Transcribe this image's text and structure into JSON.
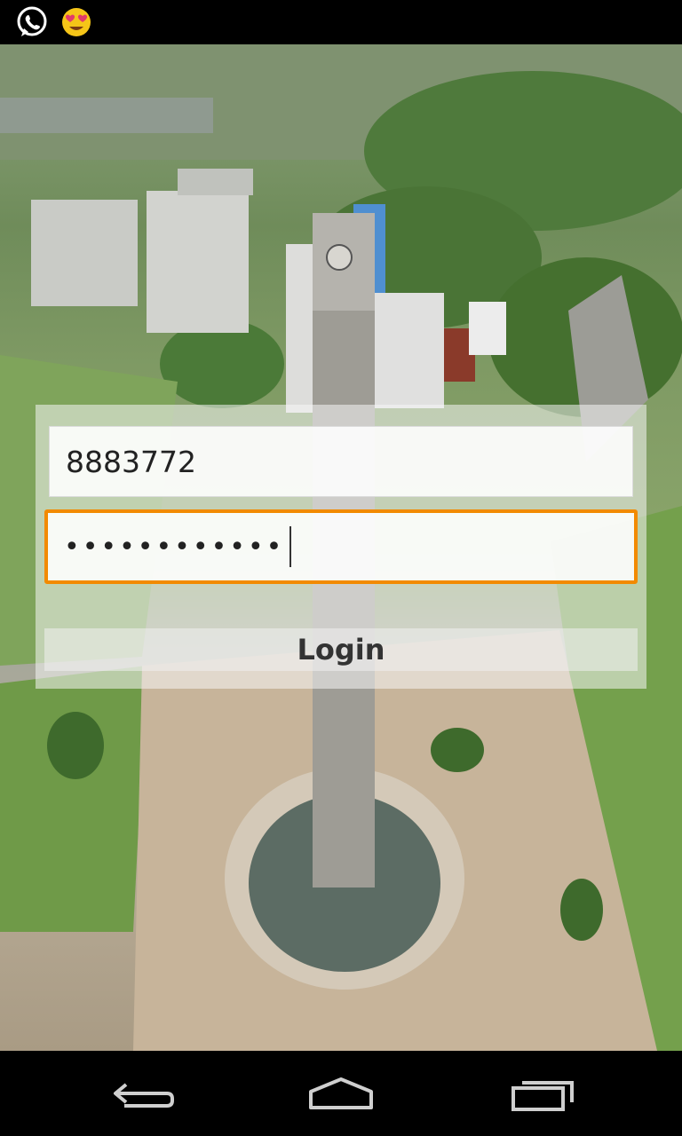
{
  "status_bar": {
    "icons": [
      "whatsapp-icon",
      "heart-eyes-emoji-icon"
    ]
  },
  "login": {
    "username_value": "8883772",
    "password_value": "••••••••••••",
    "button_label": "Login",
    "focus_color": "#f28a00"
  },
  "nav_bar": {
    "icons": [
      "back-icon",
      "home-icon",
      "recent-apps-icon"
    ]
  }
}
